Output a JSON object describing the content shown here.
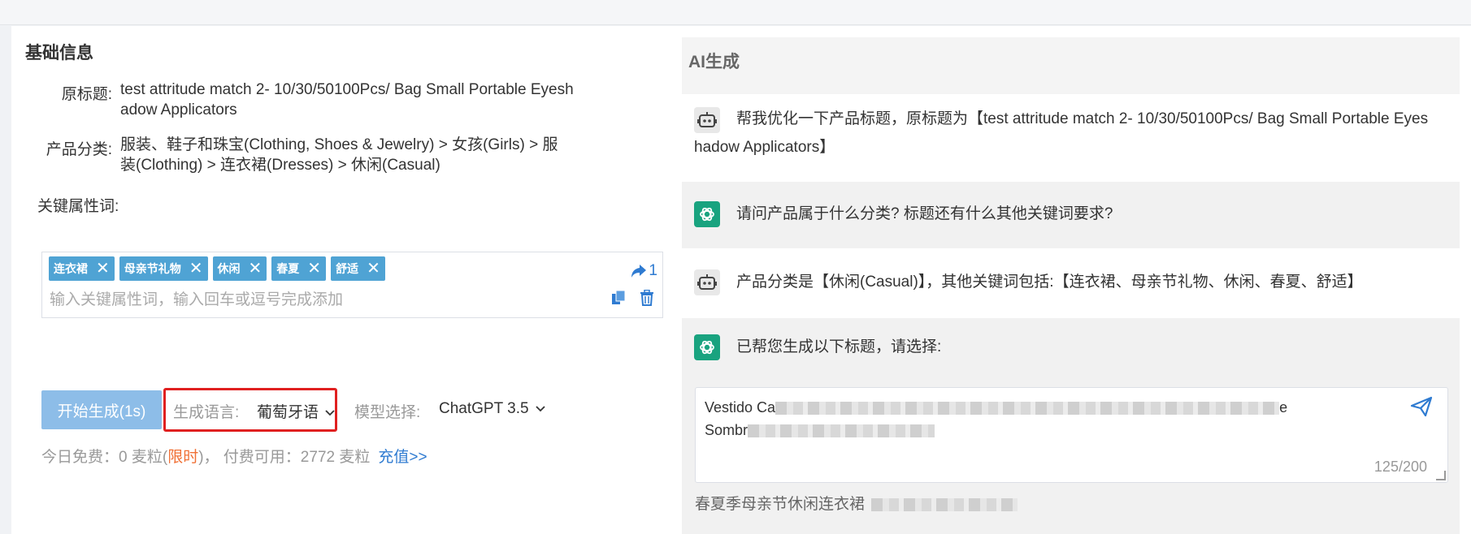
{
  "basic": {
    "title": "基础信息",
    "original_title_label": "原标题:",
    "original_title_value": "test attritude match 2- 10/30/50100Pcs/ Bag Small Portable Eyeshadow Applicators",
    "category_label": "产品分类:",
    "category_value": "服装、鞋子和珠宝(Clothing, Shoes & Jewelry)  > 女孩(Girls)  > 服装(Clothing)  > 连衣裙(Dresses)  > 休闲(Casual)",
    "keywords_label": "关键属性词:",
    "tags": [
      "连衣裙",
      "母亲节礼物",
      "休闲",
      "春夏",
      "舒适"
    ],
    "keywords_placeholder": "输入关键属性词，输入回车或逗号完成添加",
    "share_count": "1",
    "generate_button": "开始生成(1s)",
    "language_label": "生成语言:",
    "language_value": "葡萄牙语",
    "model_label": "模型选择:",
    "model_value": "ChatGPT 3.5",
    "quota_free": "今日免费：0 麦粒(",
    "quota_limited": "限时",
    "quota_paid": ")，  付费可用：2772 麦粒",
    "recharge_link": "充值>>"
  },
  "ai": {
    "title": "AI生成",
    "messages": [
      {
        "role": "user",
        "text": "帮我优化一下产品标题，原标题为【test attritude match 2- 10/30/50100Pcs/ Bag Small Portable Eyes"
      },
      {
        "role": "user",
        "text": "hadow Applicators】"
      },
      {
        "role": "assistant",
        "text": "请问产品属于什么分类?  标题还有什么其他关键词要求?"
      },
      {
        "role": "user",
        "text": "产品分类是【休闲(Casual)】，其他关键词包括:【连衣裙、母亲节礼物、休闲、春夏、舒适】"
      },
      {
        "role": "assistant",
        "text": "已帮您生成以下标题，请选择:"
      }
    ],
    "result1_start": "Vestido Ca",
    "result1_line2": "Sombr",
    "result1_tail": "e",
    "result1_counter": "125/200",
    "result2_start": "春夏季母亲节休闲连衣裙"
  },
  "colors": {
    "accent_blue": "#2f7bd1",
    "tag_blue": "#4fa3d4",
    "button_blue_disabled": "#8dbde8",
    "highlight_red": "#e02020",
    "limited_orange": "#f07035",
    "gpt_green": "#19a37f"
  },
  "icons": [
    "share-icon",
    "copy-icon",
    "trash-icon",
    "chevron-down-icon",
    "robot-icon",
    "chatgpt-icon",
    "send-icon",
    "close-icon"
  ]
}
